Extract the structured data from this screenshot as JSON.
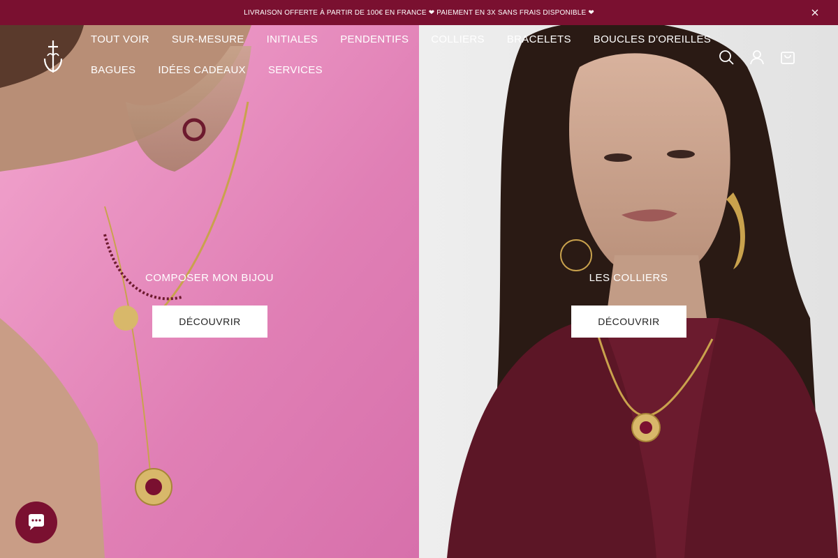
{
  "announcement": {
    "text": "LIVRAISON OFFERTE À PARTIR DE 100€ EN FRANCE ❤ PAIEMENT EN 3X SANS FRAIS DISPONIBLE ❤",
    "close_icon": "close-icon"
  },
  "brand": {
    "logo_icon": "cross-anchor-logo-icon"
  },
  "nav": {
    "row1": [
      "TOUT VOIR",
      "SUR-MESURE",
      "INITIALES",
      "PENDENTIFS",
      "COLLIERS",
      "BRACELETS",
      "BOUCLES D'OREILLES"
    ],
    "row2": [
      "BAGUES",
      "IDÉES CADEAUX",
      "SERVICES"
    ]
  },
  "tools": {
    "search_icon": "search-icon",
    "account_icon": "user-icon",
    "cart_icon": "cart-icon"
  },
  "hero": {
    "left": {
      "caption": "COMPOSER MON BIJOU",
      "button": "DÉCOUVRIR"
    },
    "right": {
      "caption": "LES COLLIERS",
      "button": "DÉCOUVRIR"
    }
  },
  "chat": {
    "icon": "chat-icon"
  },
  "colors": {
    "accent": "#7a1030",
    "left_bg": "#e48bbd",
    "right_bg": "#5c1626"
  }
}
